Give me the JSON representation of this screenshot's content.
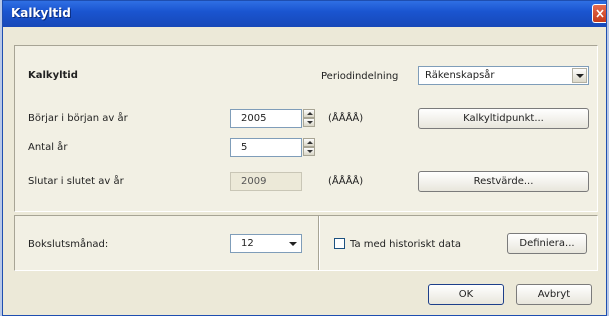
{
  "window": {
    "title": "Kalkyltid"
  },
  "section": {
    "heading": "Kalkyltid"
  },
  "periodization": {
    "label": "Periodindelning",
    "value": "Räkenskapsår"
  },
  "start": {
    "label": "Börjar i början av år",
    "value": "2005",
    "format": "(ÅÅÅÅ)"
  },
  "count": {
    "label": "Antal år",
    "value": "5"
  },
  "end": {
    "label": "Slutar i slutet av år",
    "value": "2009",
    "format": "(ÅÅÅÅ)"
  },
  "buttons": {
    "calc_point": "Kalkyltidpunkt...",
    "residual": "Restvärde...",
    "define": "Definiera...",
    "ok": "OK",
    "cancel": "Avbryt"
  },
  "closing": {
    "label": "Bokslutsmånad:",
    "value": "12"
  },
  "history": {
    "label": "Ta med historiskt data",
    "checked": false
  },
  "colors": {
    "titlebar": "#1a55d0",
    "dialog_bg": "#ece9d8"
  }
}
